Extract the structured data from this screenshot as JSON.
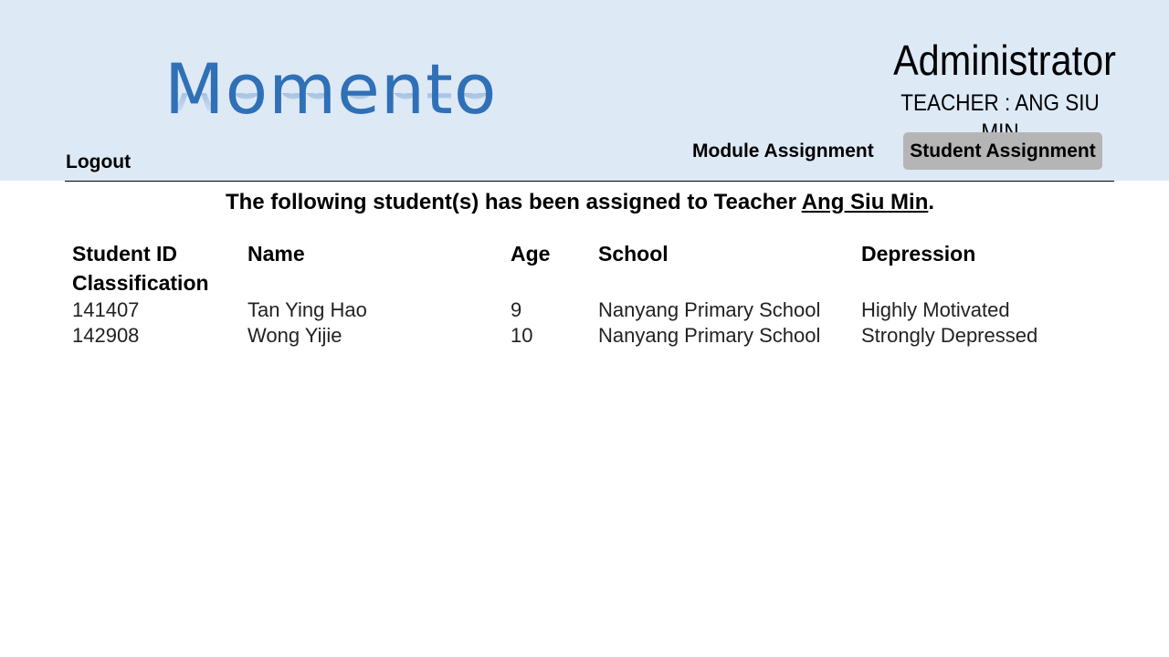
{
  "header": {
    "logo_text": "Momento",
    "logout_label": "Logout",
    "role_title": "Administrator",
    "teacher_label": "TEACHER : ANG SIU MIN",
    "nav": {
      "module_assignment": "Module Assignment",
      "student_assignment": "Student Assignment"
    },
    "colors": {
      "header_bg": "#dee9f6",
      "logo": "#2f70b7",
      "active_nav_bg": "#b5b5b5"
    }
  },
  "main": {
    "message_prefix": "The following student(s) has been assigned to Teacher ",
    "message_teacher": "Ang Siu Min",
    "message_suffix": ".",
    "table": {
      "headers": {
        "student_id": "Student ID",
        "classification": "Classification",
        "name": "Name",
        "age": "Age",
        "school": "School",
        "depression": "Depression"
      },
      "rows": [
        {
          "student_id": "141407",
          "name": "Tan Ying Hao",
          "age": "9",
          "school": "Nanyang Primary School",
          "depression": "Highly Motivated"
        },
        {
          "student_id": "142908",
          "name": "Wong Yijie",
          "age": "10",
          "school": "Nanyang Primary School",
          "depression": "Strongly Depressed"
        }
      ]
    }
  }
}
